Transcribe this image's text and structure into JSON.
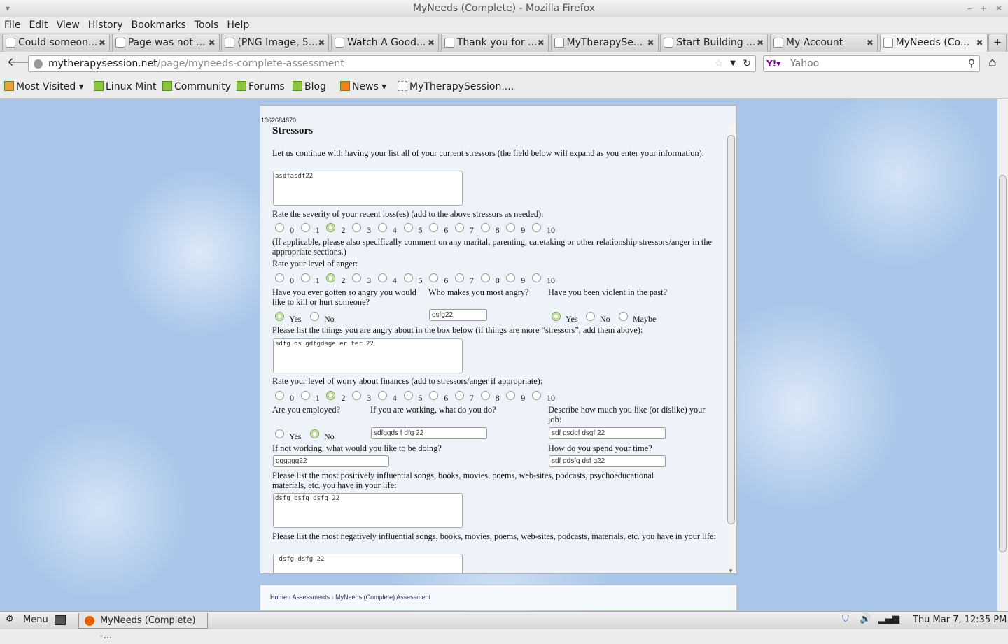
{
  "window": {
    "title": "MyNeeds (Complete) - Mozilla Firefox"
  },
  "menu": [
    "File",
    "Edit",
    "View",
    "History",
    "Bookmarks",
    "Tools",
    "Help"
  ],
  "tabs": [
    {
      "label": "Could someon..."
    },
    {
      "label": "Page was not ..."
    },
    {
      "label": "(PNG Image, 5..."
    },
    {
      "label": "Watch A Good..."
    },
    {
      "label": "Thank you for ..."
    },
    {
      "label": "MyTherapySe..."
    },
    {
      "label": "Start Building ..."
    },
    {
      "label": "My Account"
    },
    {
      "label": "MyNeeds (Co...",
      "active": true
    }
  ],
  "nav": {
    "url_domain": "mytherapysession.net",
    "url_path": "/page/myneeds-complete-assessment",
    "search_engine": "Yahoo"
  },
  "bookmarks": [
    {
      "label": "Most Visited ▾"
    },
    {
      "label": "Linux Mint"
    },
    {
      "label": "Community"
    },
    {
      "label": "Forums"
    },
    {
      "label": "Blog"
    },
    {
      "label": "News ▾"
    },
    {
      "label": "MyTherapySession...."
    }
  ],
  "form": {
    "id_text": "1362684870",
    "heading": "Stressors",
    "q_stressors": "Let us continue with having your list all of your current stressors (the field below will expand as you enter your information):",
    "stressors_value": "asdfasdf22",
    "q_loss": "Rate the severity of your recent loss(es) (add to the above stressors as needed):",
    "loss_value": 2,
    "note": "(If applicable, please also specifically comment on any marital, parenting, caretaking or other relationship stressors/anger in the appropriate sections.)",
    "q_anger": "Rate your level of anger:",
    "anger_value": 2,
    "scale": [
      "0",
      "1",
      "2",
      "3",
      "4",
      "5",
      "6",
      "7",
      "8",
      "9",
      "10"
    ],
    "q_kill": "Have you ever gotten so angry you would like to kill or hurt someone?",
    "kill_options": [
      "Yes",
      "No"
    ],
    "kill_value": "Yes",
    "q_who": "Who makes you most angry?",
    "who_value": "dsfg22",
    "q_violent": "Have you been violent in the past?",
    "violent_options": [
      "Yes",
      "No",
      "Maybe"
    ],
    "violent_value": "Yes",
    "q_angry_list": "Please list the things you are angry about in the box below (if things are more “stressors”, add them above):",
    "angry_list_value": "sdfg ds gdfgdsge er ter  22",
    "q_finances": "Rate your level of worry about finances (add to stressors/anger if appropriate):",
    "finances_value": 2,
    "q_employed": "Are you employed?",
    "employed_options": [
      "Yes",
      "No"
    ],
    "employed_value": "No",
    "q_job": "If you are working, what do you do?",
    "job_value": "sdfggds f dfg 22",
    "q_like_job": "Describe how much you like (or dislike) your job:",
    "like_job_value": "sdf gsdgf dsgf 22",
    "q_not_working": "If not working, what would you like to be doing?",
    "not_working_value": "gggggg22",
    "q_time": "How do you spend your time?",
    "time_value": "sdf gdsfg dsf g22",
    "q_positive": "Please list the most positively influential songs, books, movies, poems, web-sites, podcasts, psychoeducational materials, etc. you have in your life:",
    "positive_value": "dsfg dsfg dsfg 22",
    "q_negative": "Please list the most negatively influential songs, books, movies, poems, web-sites, podcasts, materials, etc. you have in your life:",
    "negative_value": " dsfg dsfg 22"
  },
  "breadcrumb": [
    "Home",
    "Assessments",
    "MyNeeds (Complete) Assessment"
  ],
  "taskbar": {
    "menu": "Menu",
    "window": "MyNeeds (Complete) -...",
    "clock": "Thu Mar  7, 12:35 PM"
  }
}
